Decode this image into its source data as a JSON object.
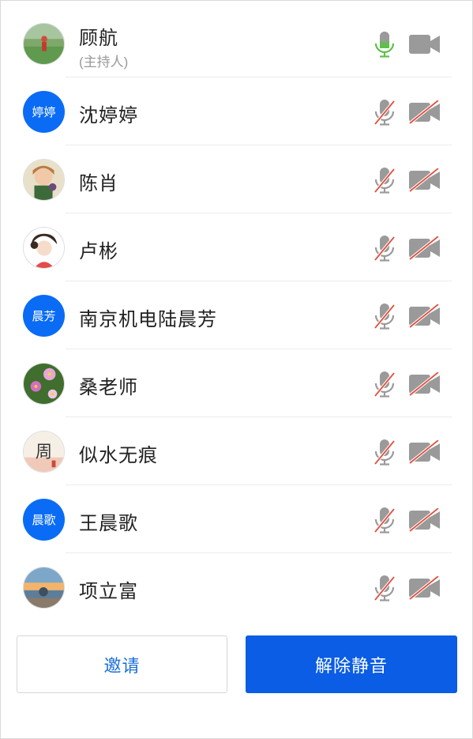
{
  "participants": [
    {
      "name": "顾航",
      "role": "(主持人)",
      "avatar_type": "image",
      "avatar_theme": "field",
      "mic": "on",
      "cam": "on"
    },
    {
      "name": "沈婷婷",
      "avatar_type": "text",
      "avatar_text": "婷婷",
      "mic": "muted",
      "cam": "off"
    },
    {
      "name": "陈肖",
      "avatar_type": "image",
      "avatar_theme": "child",
      "mic": "muted",
      "cam": "off"
    },
    {
      "name": "卢彬",
      "avatar_type": "image",
      "avatar_theme": "girl",
      "mic": "muted",
      "cam": "off"
    },
    {
      "name": "南京机电陆晨芳",
      "avatar_type": "text",
      "avatar_text": "晨芳",
      "mic": "muted",
      "cam": "off"
    },
    {
      "name": "桑老师",
      "avatar_type": "image",
      "avatar_theme": "flowers",
      "mic": "muted",
      "cam": "off"
    },
    {
      "name": "似水无痕",
      "avatar_type": "image",
      "avatar_theme": "seal",
      "avatar_char": "周",
      "mic": "muted",
      "cam": "off"
    },
    {
      "name": "王晨歌",
      "avatar_type": "text",
      "avatar_text": "晨歌",
      "mic": "muted",
      "cam": "off"
    },
    {
      "name": "项立富",
      "avatar_type": "image",
      "avatar_theme": "sunset",
      "mic": "muted",
      "cam": "off"
    }
  ],
  "buttons": {
    "invite": "邀请",
    "unmute": "解除静音"
  },
  "colors": {
    "accent": "#0a5de4",
    "avatar_blue": "#0a6cf5",
    "mic_on": "#5fbf4a",
    "icon_gray": "#9a9a9a",
    "strike_red": "#e0513f"
  },
  "icons": {
    "mic": "microphone-icon",
    "cam": "video-camera-icon"
  }
}
